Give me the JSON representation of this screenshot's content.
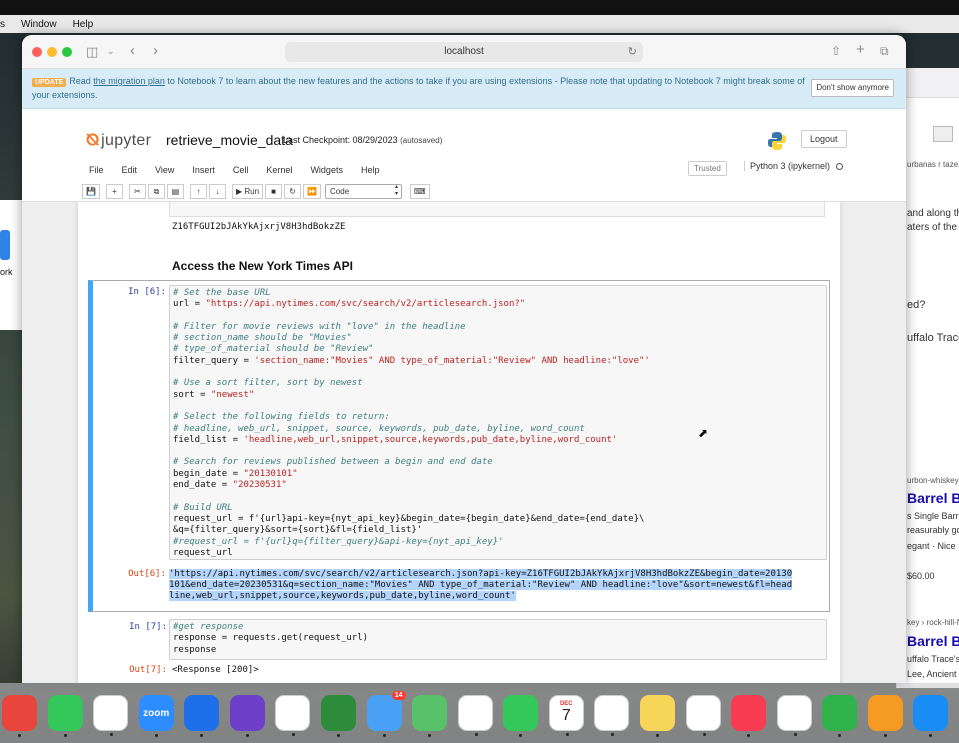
{
  "menubar": {
    "items": [
      "s",
      "Window",
      "Help"
    ]
  },
  "browser": {
    "url": "localhost"
  },
  "banner": {
    "badge": "UPDATE",
    "text_before": "Read ",
    "link": "the migration plan",
    "text_after": " to Notebook 7 to learn about the new features and the actions to take if you are using extensions - Please note that updating to Notebook 7 might break some of your extensions.",
    "dismiss": "Don't show anymore"
  },
  "header": {
    "logo": "jupyter",
    "notebook_name": "retrieve_movie_data",
    "checkpoint": "Last Checkpoint: 08/29/2023",
    "autosaved": "(autosaved)",
    "logout": "Logout"
  },
  "menu": [
    "File",
    "Edit",
    "View",
    "Insert",
    "Cell",
    "Kernel",
    "Widgets",
    "Help"
  ],
  "trusted": "Trusted",
  "kernel": "Python 3 (ipykernel)",
  "toolbar": {
    "run_label": "Run",
    "cell_type": "Code"
  },
  "notebook": {
    "prev_output": "Z16TFGUI2bJAkYkAjxrjV8H3hdBokzZE",
    "heading": "Access the New York Times API",
    "cell6_prompt": "In [6]:",
    "cell6_lines": [
      {
        "c": "# Set the base URL"
      },
      {
        "t": "url = ",
        "s": "\"https://api.nytimes.com/svc/search/v2/articlesearch.json?\""
      },
      {
        "t": ""
      },
      {
        "c": "# Filter for movie reviews with \"love\" in the headline"
      },
      {
        "c": "# section_name should be \"Movies\""
      },
      {
        "c": "# type_of_material should be \"Review\""
      },
      {
        "t": "filter_query = ",
        "s": "'section_name:\"Movies\" AND type_of_material:\"Review\" AND headline:\"love\"'"
      },
      {
        "t": ""
      },
      {
        "c": "# Use a sort filter, sort by newest"
      },
      {
        "t": "sort = ",
        "s": "\"newest\""
      },
      {
        "t": ""
      },
      {
        "c": "# Select the following fields to return:"
      },
      {
        "c": "# headline, web_url, snippet, source, keywords, pub_date, byline, word_count"
      },
      {
        "t": "field_list = ",
        "s": "'headline,web_url,snippet,source,keywords,pub_date,byline,word_count'"
      },
      {
        "t": ""
      },
      {
        "c": "# Search for reviews published between a begin and end date"
      },
      {
        "t": "begin_date = ",
        "s": "\"20130101\""
      },
      {
        "t": "end_date = ",
        "s": "\"20230531\""
      },
      {
        "t": ""
      },
      {
        "c": "# Build URL"
      },
      {
        "t": "request_url = f'{url}api-key={nyt_api_key}&begin_date={begin_date}&end_date={end_date}\\"
      },
      {
        "t": "&q={filter_query}&sort={sort}&fl={field_list}'"
      },
      {
        "c": "#request_url = f'{url}q={filter_query}&api-key={nyt_api_key}'"
      },
      {
        "t": "request_url"
      }
    ],
    "out6_prompt": "Out[6]:",
    "out6_lines": [
      "'https://api.nytimes.com/svc/search/v2/articlesearch.json?api-key=Z16TFGUI2bJAkYkAjxrjV8H3hdBokzZE&begin_date=20130",
      "101&end_date=20230531&q=section_name:\"Movies\" AND type_of_material:\"Review\" AND headline:\"love\"&sort=newest&fl=head",
      "line,web_url,snippet,source,keywords,pub_date,byline,word_count'"
    ],
    "cell7_prompt": "In [7]:",
    "cell7_lines": [
      {
        "c": "#get response"
      },
      {
        "t": "response = requests.get(request_url)"
      },
      {
        "t": "response"
      }
    ],
    "out7_prompt": "Out[7]:",
    "out7_text": "<Response [200]>"
  },
  "bg_window": {
    "lines": [
      "urbanas r taze...",
      "and along the",
      "aters of the K",
      "ed?",
      "uffalo Trace",
      "urbon-whiskey >",
      "Barrel Bo",
      "s Single Barr",
      "reasurably go",
      "egant · Nice",
      "$60.00",
      "key › rock-hill-f",
      "Barrel Bo",
      "uffalo Trace's",
      "Lee, Ancient"
    ]
  },
  "left_bg": {
    "text": "ork"
  },
  "dock": {
    "apps": [
      {
        "name": "chrome",
        "color": "#e8453c",
        "label": ""
      },
      {
        "name": "messages",
        "color": "#34c759",
        "label": ""
      },
      {
        "name": "slack",
        "color": "#ffffff",
        "label": ""
      },
      {
        "name": "zoom",
        "color": "#2d8cff",
        "label": "zoom"
      },
      {
        "name": "xcode",
        "color": "#1f6feb",
        "label": ""
      },
      {
        "name": "github-desktop",
        "color": "#6e40c9",
        "label": ""
      },
      {
        "name": "vscode",
        "color": "#ffffff",
        "label": ""
      },
      {
        "name": "app-circle",
        "color": "#2c8c3a",
        "label": ""
      },
      {
        "name": "mail",
        "color": "#4aa0f5",
        "label": "",
        "badge": "14"
      },
      {
        "name": "maps",
        "color": "#58c26b",
        "label": ""
      },
      {
        "name": "photos",
        "color": "#ffffff",
        "label": ""
      },
      {
        "name": "facetime",
        "color": "#34c759",
        "label": ""
      },
      {
        "name": "calendar",
        "color": "#ffffff",
        "label": "7",
        "sublabel": "DEC"
      },
      {
        "name": "reminders",
        "color": "#ffffff",
        "label": ""
      },
      {
        "name": "notes",
        "color": "#f7d559",
        "label": ""
      },
      {
        "name": "freeform",
        "color": "#ffffff",
        "label": ""
      },
      {
        "name": "music",
        "color": "#fa3c52",
        "label": ""
      },
      {
        "name": "news",
        "color": "#ffffff",
        "label": ""
      },
      {
        "name": "numbers",
        "color": "#2fb34a",
        "label": ""
      },
      {
        "name": "pages",
        "color": "#f59a23",
        "label": ""
      },
      {
        "name": "app-store",
        "color": "#1a8cf5",
        "label": ""
      }
    ]
  }
}
